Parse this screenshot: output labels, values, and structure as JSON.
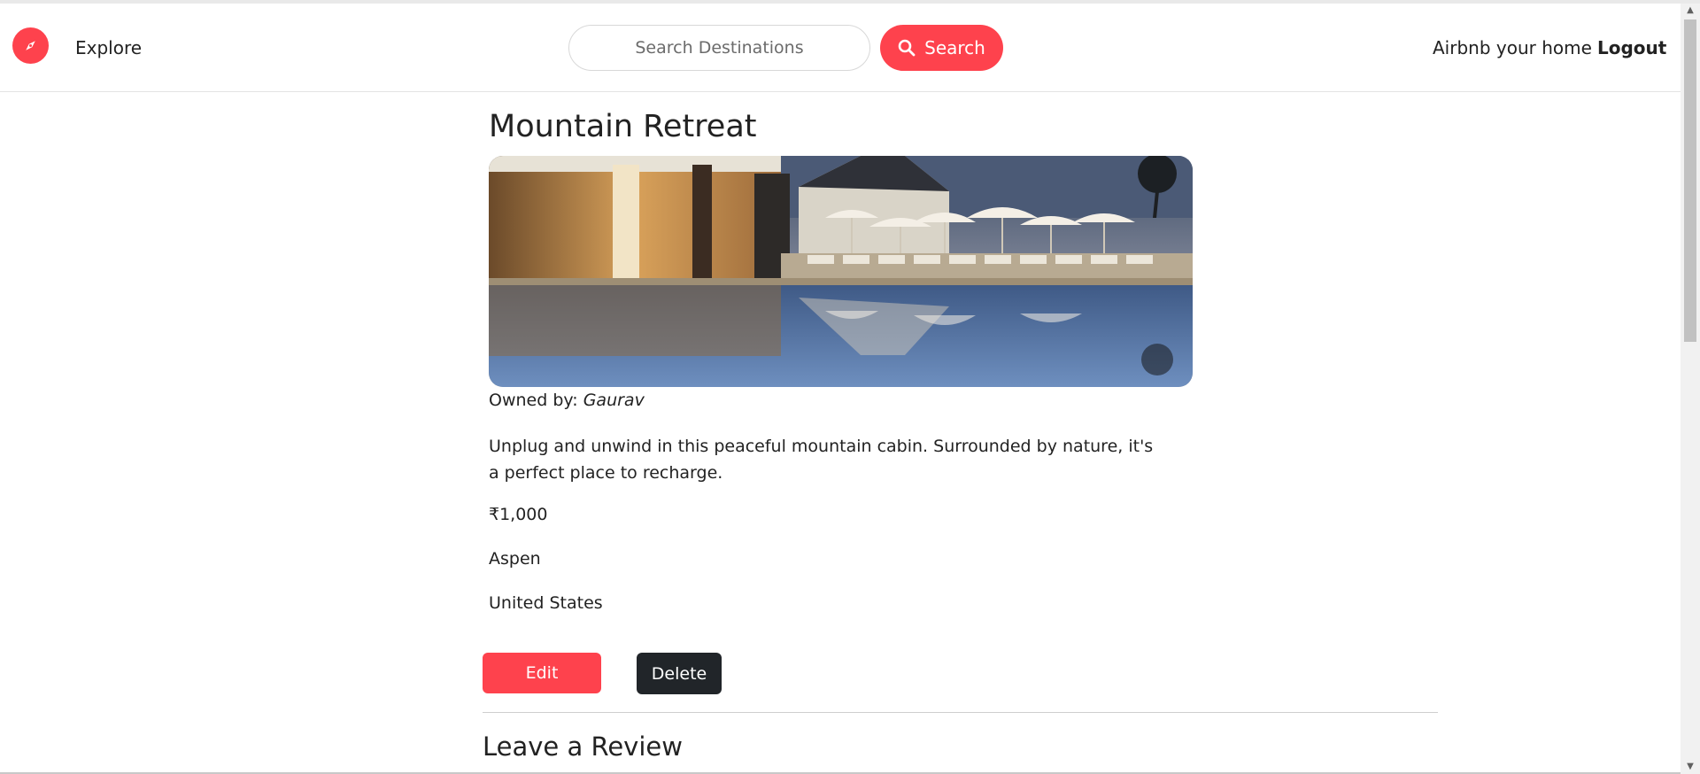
{
  "navbar": {
    "logo_icon": "compass-icon",
    "brand_color": "#fe424d",
    "explore_label": "Explore",
    "search": {
      "placeholder": "Search Destinations",
      "value": "",
      "button_label": "Search",
      "button_icon": "search-icon"
    },
    "host_label": "Airbnb your home",
    "logout_label": "Logout"
  },
  "listing": {
    "title": "Mountain Retreat",
    "image_alt": "Resort pool at dusk",
    "owner_prefix": "Owned by: ",
    "owner_name": "Gaurav",
    "description": "Unplug and unwind in this peaceful mountain cabin. Surrounded by nature, it's a perfect place to recharge.",
    "price": "₹1,000",
    "location": "Aspen",
    "country": "United States"
  },
  "actions": {
    "edit_label": "Edit",
    "delete_label": "Delete"
  },
  "reviews": {
    "heading": "Leave a Review"
  }
}
